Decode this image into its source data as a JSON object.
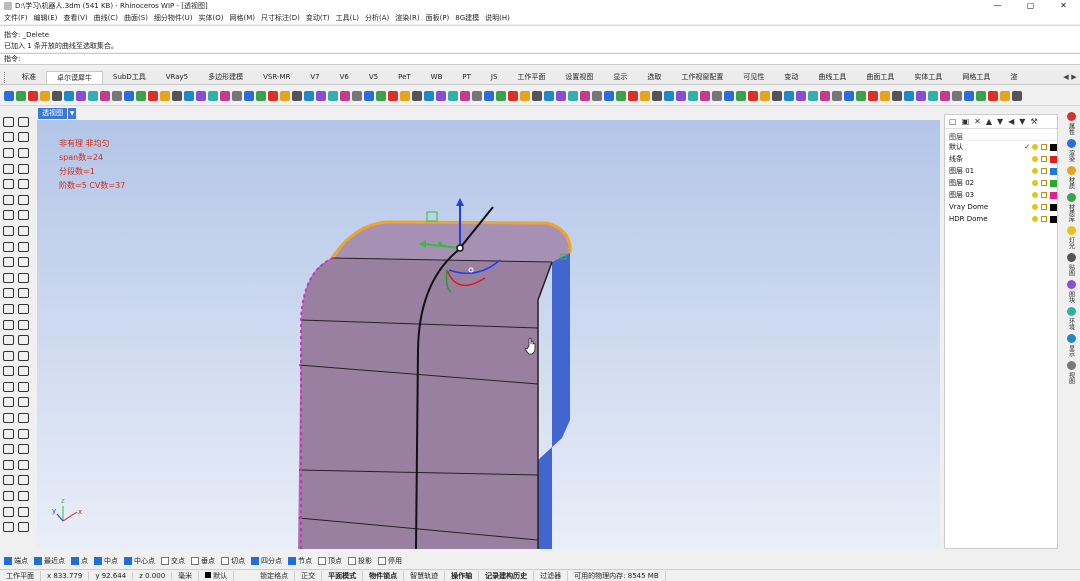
{
  "titlebar": {
    "title": "D:\\学习\\机器人.3dm (541 KB) - Rhinoceros WIP - [透视图]",
    "minimize": "—",
    "maximize": "▢",
    "close": "✕"
  },
  "menu": [
    "文件(F)",
    "编辑(E)",
    "查看(V)",
    "曲线(C)",
    "曲面(S)",
    "细分物件(U)",
    "实体(O)",
    "网格(M)",
    "尺寸标注(D)",
    "变动(T)",
    "工具(L)",
    "分析(A)",
    "渲染(R)",
    "面板(P)",
    "8G建模",
    "说明(H)"
  ],
  "command_history": [
    "指令: _Delete",
    "已加入 1 条开放的曲线至选取集合。"
  ],
  "command_prompt": {
    "label": "指令:",
    "value": ""
  },
  "tabs": [
    "标准",
    "卓尔谟犀牛",
    "SubD工具",
    "VRay5",
    "多边形建模",
    "VSR-MR",
    "V7",
    "V6",
    "V5",
    "PeT",
    "WB",
    "PT",
    "JS",
    "工作平面",
    "设置视图",
    "显示",
    "选取",
    "工作视窗配置",
    "可见性",
    "变动",
    "曲线工具",
    "曲面工具",
    "实体工具",
    "网格工具",
    "渲"
  ],
  "tab_active_index": 1,
  "tab_nav": {
    "left": "◀",
    "right": "▶"
  },
  "viewport": {
    "name": "透视图",
    "menu_arrow": "▼",
    "notes": [
      "非有理  非均匀",
      "span数=24",
      "分段数=1",
      "阶数=5   CV数=37"
    ],
    "axis_z": "z",
    "axis_x": "x",
    "axis_y": "y"
  },
  "layers_panel": {
    "title": "图层",
    "layers": [
      {
        "name": "默认",
        "current": "✓",
        "color": "#000000"
      },
      {
        "name": "线条",
        "current": "",
        "color": "#e02020"
      },
      {
        "name": "图层 01",
        "current": "",
        "color": "#1e78d8"
      },
      {
        "name": "图层 02",
        "current": "",
        "color": "#2aaa2a"
      },
      {
        "name": "图层 03",
        "current": "",
        "color": "#e0208c"
      },
      {
        "name": "Vray Dome",
        "current": "",
        "color": "#000000"
      },
      {
        "name": "HDR Dome",
        "current": "",
        "color": "#000000"
      }
    ]
  },
  "right_tabs": [
    "属性",
    "渲染",
    "材质",
    "材质库",
    "灯光",
    "贴图",
    "图块",
    "环境",
    "显示",
    "视图"
  ],
  "osnap": [
    {
      "label": "端点",
      "on": true
    },
    {
      "label": "最近点",
      "on": true
    },
    {
      "label": "点",
      "on": true
    },
    {
      "label": "中点",
      "on": true
    },
    {
      "label": "中心点",
      "on": true
    },
    {
      "label": "交点",
      "on": false
    },
    {
      "label": "垂点",
      "on": false
    },
    {
      "label": "切点",
      "on": false
    },
    {
      "label": "四分点",
      "on": true
    },
    {
      "label": "节点",
      "on": true
    },
    {
      "label": "顶点",
      "on": false
    },
    {
      "label": "投影",
      "on": false
    },
    {
      "label": "停用",
      "on": false
    }
  ],
  "status": {
    "cplane": "工作平面",
    "x": "x 833.779",
    "y": "y 92.644",
    "z": "z 0.000",
    "unit": "毫米",
    "layer": "默认",
    "grid_snap": "锁定格点",
    "ortho": "正交",
    "planar": "平面模式",
    "osnap": "物件锁点",
    "smarttrack": "智慧轨迹",
    "gumball": "操作轴",
    "history": "记录建构历史",
    "filter": "过滤器",
    "memory": "可用的物理内存: 8545 MB"
  }
}
